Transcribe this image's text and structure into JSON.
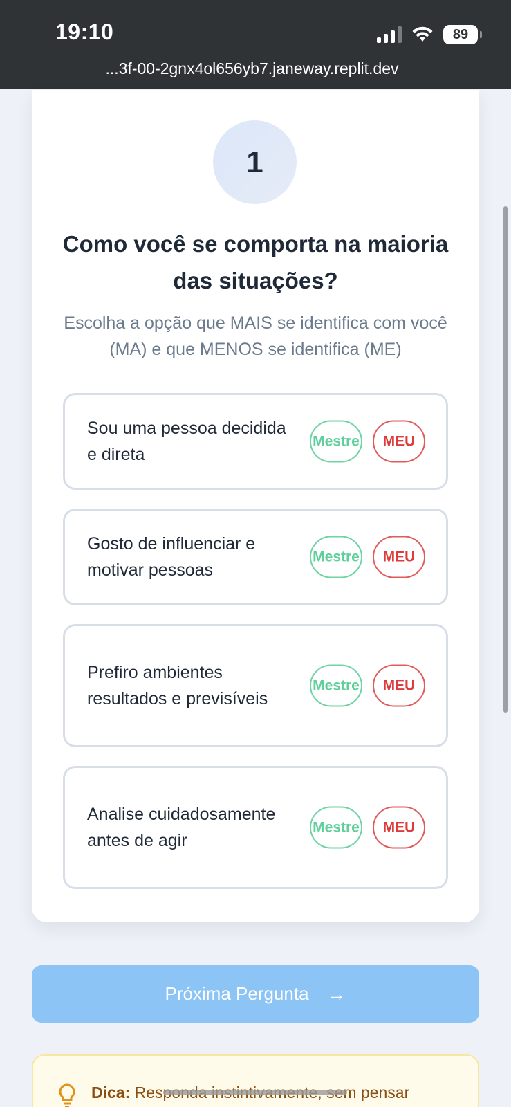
{
  "status_bar": {
    "time": "19:10",
    "battery": "89"
  },
  "browser": {
    "url": "...3f-00-2gnx4ol656yb7.janeway.replit.dev"
  },
  "question": {
    "number": "1",
    "title": "Como você se comporta na maioria das situações?",
    "subtitle": "Escolha a opção que MAIS se identifica com você (MA) e que MENOS se identifica (ME)"
  },
  "options": [
    {
      "label": "Sou uma pessoa decidida e direta",
      "most_label": "Mestre",
      "least_label": "MEU"
    },
    {
      "label": "Gosto de influenciar e motivar pessoas",
      "most_label": "Mestre",
      "least_label": "MEU"
    },
    {
      "label": "Prefiro ambientes resultados e previsíveis",
      "most_label": "Mestre",
      "least_label": "MEU"
    },
    {
      "label": "Analise cuidadosamente antes de agir",
      "most_label": "Mestre",
      "least_label": "MEU"
    }
  ],
  "next_button": {
    "label": "Próxima Pergunta"
  },
  "tip": {
    "prefix": "Dica:",
    "text": "Responda instintivamente, sem pensar"
  },
  "colors": {
    "most": "#5fcf9b",
    "least": "#dc3c3c",
    "primary_disabled": "#8cc4f5"
  }
}
